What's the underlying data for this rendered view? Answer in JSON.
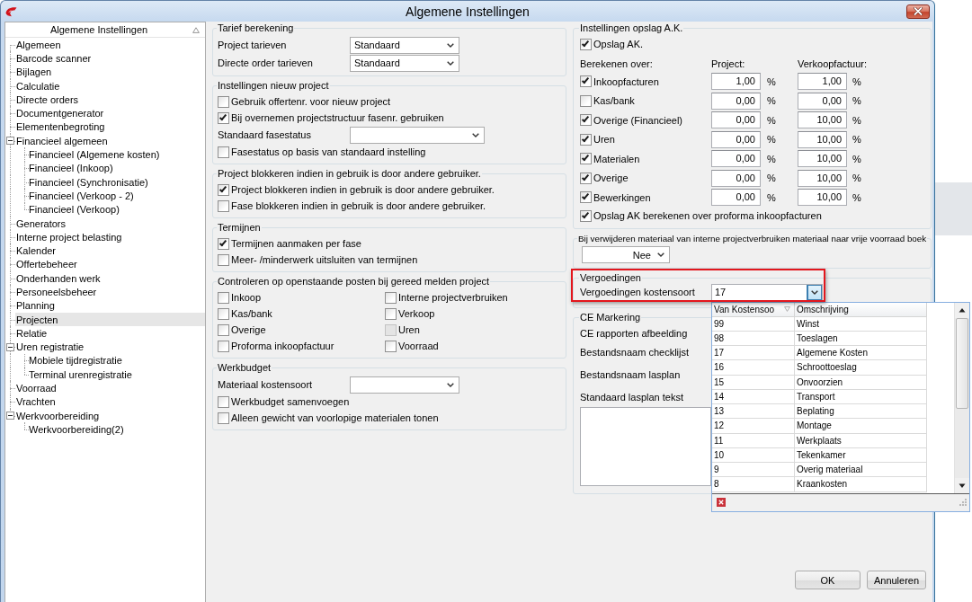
{
  "window": {
    "title": "Algemene Instellingen"
  },
  "sidebar": {
    "header": "Algemene Instellingen",
    "items": [
      {
        "label": "Algemeen",
        "selected": false
      },
      {
        "label": "Barcode scanner",
        "selected": false
      },
      {
        "label": "Bijlagen",
        "selected": false
      },
      {
        "label": "Calculatie",
        "selected": false
      },
      {
        "label": "Directe orders",
        "selected": false
      },
      {
        "label": "Documentgenerator",
        "selected": false
      },
      {
        "label": "Elementenbegroting",
        "selected": false
      },
      {
        "label": "Financieel algemeen",
        "selected": false,
        "expanded": true,
        "children": [
          {
            "label": "Financieel (Algemene kosten)",
            "selected": false
          },
          {
            "label": "Financieel (Inkoop)",
            "selected": false
          },
          {
            "label": "Financieel (Synchronisatie)",
            "selected": false
          },
          {
            "label": "Financieel (Verkoop - 2)",
            "selected": false
          },
          {
            "label": "Financieel (Verkoop)",
            "selected": false
          }
        ]
      },
      {
        "label": "Generators",
        "selected": false
      },
      {
        "label": "Interne project belasting",
        "selected": false
      },
      {
        "label": "Kalender",
        "selected": false
      },
      {
        "label": "Offertebeheer",
        "selected": false
      },
      {
        "label": "Onderhanden werk",
        "selected": false
      },
      {
        "label": "Personeelsbeheer",
        "selected": false
      },
      {
        "label": "Planning",
        "selected": false
      },
      {
        "label": "Projecten",
        "selected": true
      },
      {
        "label": "Relatie",
        "selected": false
      },
      {
        "label": "Uren registratie",
        "selected": false,
        "expanded": true,
        "children": [
          {
            "label": "Mobiele tijdregistratie",
            "selected": false
          },
          {
            "label": "Terminal urenregistratie",
            "selected": false
          }
        ]
      },
      {
        "label": "Voorraad",
        "selected": false
      },
      {
        "label": "Vrachten",
        "selected": false
      },
      {
        "label": "Werkvoorbereiding",
        "selected": false,
        "expanded": true,
        "children": [
          {
            "label": "Werkvoorbereiding(2)",
            "selected": false
          }
        ]
      }
    ]
  },
  "project_settings": [
    {
      "title": "Tarief berekening",
      "kind": "form",
      "rows": [
        {
          "kind": "select",
          "label": "Project tarieven",
          "value": "Standaard"
        },
        {
          "kind": "select",
          "label": "Directe order tarieven",
          "value": "Standaard"
        }
      ]
    },
    {
      "title": "Instellingen nieuw project",
      "kind": "form",
      "rows": [
        {
          "kind": "checkbox",
          "label": "Gebruik offertenr. voor nieuw project",
          "checked": false
        },
        {
          "kind": "checkbox",
          "label": "Bij overnemen projectstructuur fasenr. gebruiken",
          "checked": true
        },
        {
          "kind": "select",
          "label": "Standaard fasestatus"
        },
        {
          "kind": "checkbox",
          "label": "Fasestatus op basis van standaard instelling",
          "checked": false
        }
      ]
    },
    {
      "title": "Project blokkeren indien in gebruik is door andere gebruiker.",
      "kind": "form",
      "rows": [
        {
          "kind": "checkbox",
          "label": "Project blokkeren indien in gebruik is door andere gebruiker.",
          "checked": true
        },
        {
          "kind": "checkbox",
          "label": "Fase blokkeren indien in gebruik is door andere gebruiker.",
          "checked": false
        }
      ]
    },
    {
      "title": "Termijnen",
      "kind": "form",
      "rows": [
        {
          "kind": "checkbox",
          "label": "Termijnen aanmaken per fase",
          "checked": true
        },
        {
          "kind": "checkbox",
          "label": "Meer- /minderwerk uitsluiten van termijnen",
          "checked": false
        }
      ]
    },
    {
      "title": "Controleren op openstaande posten bij gereed melden project",
      "kind": "grid",
      "rows": [
        {
          "kind": "checkbox",
          "label": "Inkoop",
          "checked": false,
          "disabled": false
        },
        {
          "kind": "checkbox",
          "label": "Interne projectverbruiken",
          "checked": false,
          "disabled": false
        },
        {
          "kind": "checkbox",
          "label": "Kas/bank",
          "checked": false,
          "disabled": false
        },
        {
          "kind": "checkbox",
          "label": "Verkoop",
          "checked": false,
          "disabled": false
        },
        {
          "kind": "checkbox",
          "label": "Overige",
          "checked": false,
          "disabled": false
        },
        {
          "kind": "checkbox",
          "label": "Uren",
          "checked": false,
          "disabled": true
        },
        {
          "kind": "checkbox",
          "label": "Proforma inkoopfactuur",
          "checked": false,
          "disabled": false
        },
        {
          "kind": "checkbox",
          "label": "Voorraad",
          "checked": false,
          "disabled": false
        }
      ]
    },
    {
      "title": "Werkbudget",
      "kind": "form",
      "rows": [
        {
          "kind": "select",
          "label": "Materiaal kostensoort"
        },
        {
          "kind": "checkbox",
          "label": "Werkbudget samenvoegen",
          "checked": false
        },
        {
          "kind": "checkbox",
          "label": "Alleen gewicht van voorlopige materialen tonen",
          "checked": false
        }
      ]
    }
  ],
  "opslag": {
    "title": "Instellingen opslag A.K.",
    "enabled": {
      "label": "Opslag AK.",
      "checked": true
    },
    "columns": [
      "Berekenen over:",
      "Project:",
      "Verkoopfactuur:"
    ],
    "rows": [
      {
        "label": "Inkoopfacturen",
        "checked": true,
        "project": "1,00",
        "project_unit": "%",
        "invoice": "1,00",
        "invoice_unit": "%"
      },
      {
        "label": "Kas/bank",
        "checked": false,
        "project": "0,00",
        "project_unit": "%",
        "invoice": "0,00",
        "invoice_unit": "%"
      },
      {
        "label": "Overige (Financieel)",
        "checked": true,
        "project": "0,00",
        "project_unit": "%",
        "invoice": "10,00",
        "invoice_unit": "%"
      },
      {
        "label": "Uren",
        "checked": true,
        "project": "0,00",
        "project_unit": "%",
        "invoice": "10,00",
        "invoice_unit": "%"
      },
      {
        "label": "Materialen",
        "checked": true,
        "project": "0,00",
        "project_unit": "%",
        "invoice": "10,00",
        "invoice_unit": "%"
      },
      {
        "label": "Overige",
        "checked": true,
        "project": "0,00",
        "project_unit": "%",
        "invoice": "10,00",
        "invoice_unit": "%"
      },
      {
        "label": "Bewerkingen",
        "checked": true,
        "project": "0,00",
        "project_unit": "%",
        "invoice": "10,00",
        "invoice_unit": "%"
      }
    ],
    "proforma": {
      "label": "Opslag AK berekenen over proforma inkoopfacturen",
      "checked": true
    }
  },
  "material_removal": {
    "title": "Bij verwijderen materiaal van interne projectverbruiken materiaal naar vrije voorraad boek",
    "value": "Nee"
  },
  "vergoedingen": {
    "title": "Vergoedingen",
    "label": "Vergoedingen kostensoort",
    "value": "17",
    "expanded": true,
    "list": {
      "columns": [
        "Van Kostensoo",
        "Omschrijving"
      ],
      "rows": [
        {
          "code": "99",
          "description": "Winst"
        },
        {
          "code": "98",
          "description": "Toeslagen"
        },
        {
          "code": "17",
          "description": "Algemene Kosten"
        },
        {
          "code": "16",
          "description": "Schroottoeslag"
        },
        {
          "code": "15",
          "description": "Onvoorzien"
        },
        {
          "code": "14",
          "description": "Transport"
        },
        {
          "code": "13",
          "description": "Beplating"
        },
        {
          "code": "12",
          "description": "Montage"
        },
        {
          "code": "11",
          "description": "Werkplaats"
        },
        {
          "code": "10",
          "description": "Tekenkamer"
        },
        {
          "code": "9",
          "description": "Overig materiaal"
        },
        {
          "code": "8",
          "description": "Kraankosten"
        }
      ]
    }
  },
  "ce_markering": {
    "title": "CE Markering",
    "labels": [
      "CE rapporten afbeelding",
      "Bestandsnaam checklijst",
      "Bestandsnaam lasplan",
      "Standaard lasplan tekst"
    ]
  },
  "buttons": [
    "OK",
    "Annuleren"
  ]
}
